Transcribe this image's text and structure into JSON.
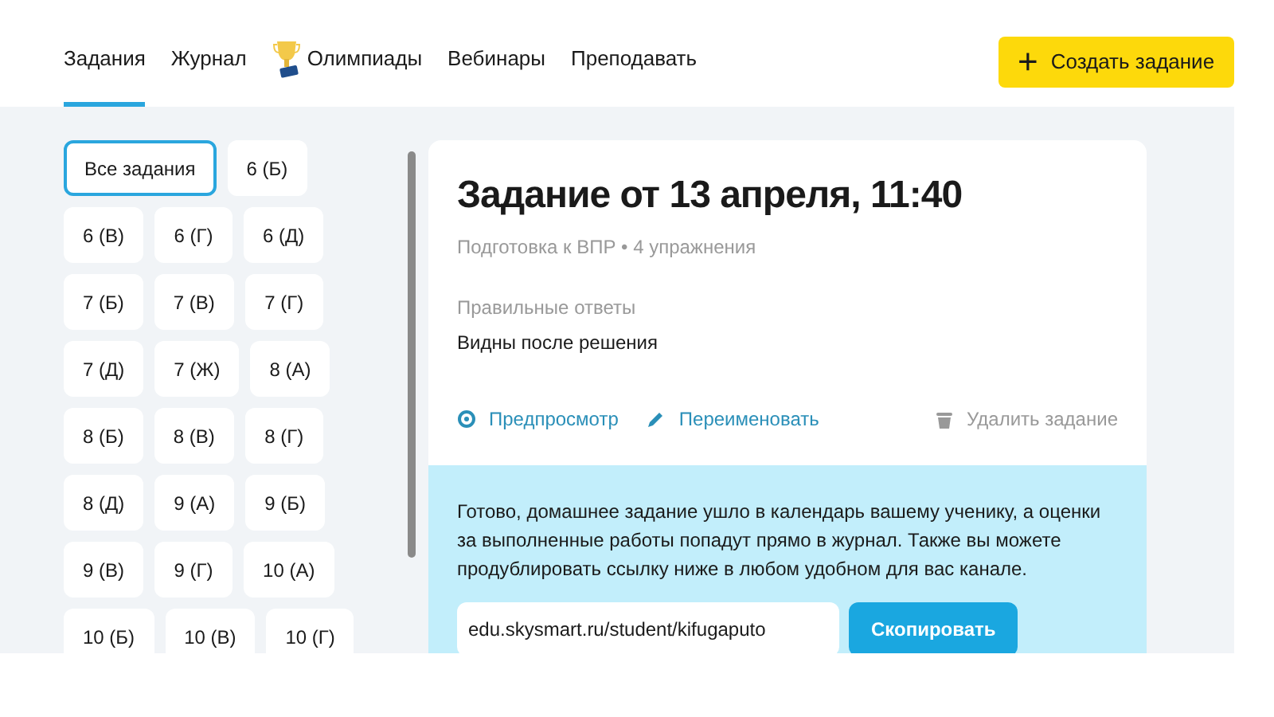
{
  "nav": {
    "tabs": [
      {
        "label": "Задания",
        "selected": true,
        "kind": "plain"
      },
      {
        "label": "Журнал",
        "selected": false,
        "kind": "plain"
      },
      {
        "label": "Олимпиады",
        "selected": false,
        "kind": "trophy"
      },
      {
        "label": "Вебинары",
        "selected": false,
        "kind": "plain"
      },
      {
        "label": "Преподавать",
        "selected": false,
        "kind": "plain"
      }
    ],
    "create_button": {
      "icon": "+",
      "label": "Создать задание"
    }
  },
  "groups": [
    {
      "label": "Все задания",
      "selected": true
    },
    {
      "label": "6 (Б)",
      "selected": false
    },
    {
      "label": "6 (В)",
      "selected": false
    },
    {
      "label": "6 (Г)",
      "selected": false
    },
    {
      "label": "6 (Д)",
      "selected": false
    },
    {
      "label": "7 (Б)",
      "selected": false
    },
    {
      "label": "7 (В)",
      "selected": false
    },
    {
      "label": "7 (Г)",
      "selected": false
    },
    {
      "label": "7 (Д)",
      "selected": false
    },
    {
      "label": "7 (Ж)",
      "selected": false
    },
    {
      "label": "8 (А)",
      "selected": false
    },
    {
      "label": "8 (Б)",
      "selected": false
    },
    {
      "label": "8 (В)",
      "selected": false
    },
    {
      "label": "8 (Г)",
      "selected": false
    },
    {
      "label": "8 (Д)",
      "selected": false
    },
    {
      "label": "9 (А)",
      "selected": false
    },
    {
      "label": "9 (Б)",
      "selected": false
    },
    {
      "label": "9 (В)",
      "selected": false
    },
    {
      "label": "9 (Г)",
      "selected": false
    },
    {
      "label": "10 (А)",
      "selected": false
    },
    {
      "label": "10 (Б)",
      "selected": false
    },
    {
      "label": "10 (В)",
      "selected": false
    },
    {
      "label": "10 (Г)",
      "selected": false
    }
  ],
  "assignment": {
    "title": "Задание от 13 апреля, 11:40",
    "subtitle": "Подготовка к ВПР • 4 упражнения",
    "answers_label": "Правильные ответы",
    "answers_value": "Видны после решения",
    "actions": [
      {
        "kind": "preview",
        "label": "Предпросмотр"
      },
      {
        "kind": "rename",
        "label": "Переименовать"
      },
      {
        "kind": "delete",
        "label": "Удалить задание"
      }
    ],
    "notice": "Готово, домашнее задание ушло в календарь вашему ученику, а оценки за выполненные работы попадут прямо в журнал. Также вы можете продублировать ссылку ниже в любом удобном для вас канале.",
    "link": "edu.skysmart.ru/student/kifugaputo",
    "copy_button": "Скопировать"
  }
}
